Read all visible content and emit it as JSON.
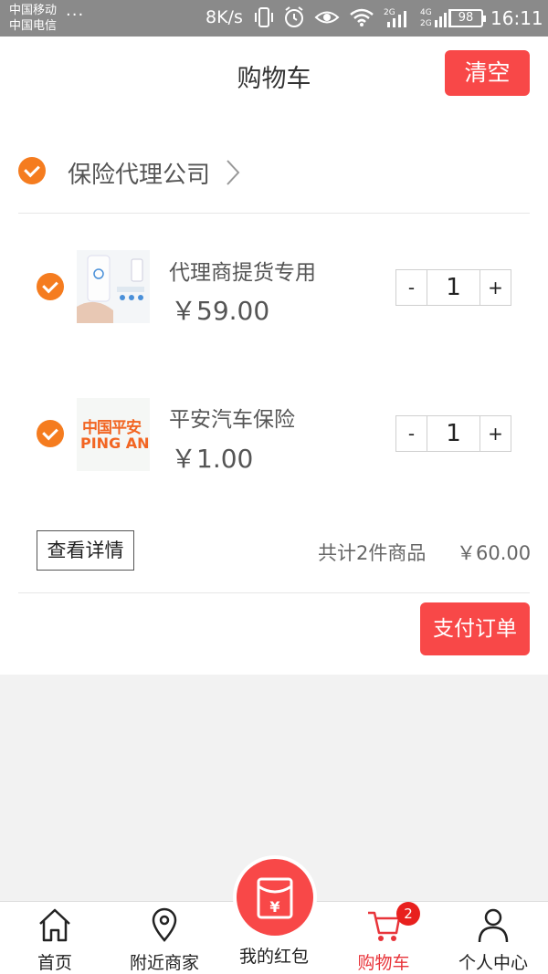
{
  "status_bar": {
    "carrier1": "中国移动",
    "carrier2": "中国电信",
    "more": "···",
    "speed": "8K/s",
    "battery": "98",
    "time": "16:11"
  },
  "header": {
    "title": "购物车",
    "clear_label": "清空"
  },
  "shop": {
    "name": "保险代理公司",
    "checked": true
  },
  "items": [
    {
      "name": "代理商提货专用",
      "price": "￥59.00",
      "qty": "1",
      "minus": "-",
      "plus": "+",
      "checked": true,
      "image": "dispenser-product-image"
    },
    {
      "name": "平安汽车保险",
      "price": "￥1.00",
      "qty": "1",
      "minus": "-",
      "plus": "+",
      "checked": true,
      "image": "pingan-logo-image"
    }
  ],
  "footer": {
    "detail_label": "查看详情",
    "summary": "共计2件商品",
    "total": "￥60.00",
    "pay_label": "支付订单"
  },
  "logo_text": {
    "line1": "中国平安",
    "line2": "PING AN"
  },
  "bottom_nav": {
    "items": [
      {
        "label": "首页",
        "icon": "home-icon"
      },
      {
        "label": "附近商家",
        "icon": "location-pin-icon"
      },
      {
        "label": "我的红包",
        "icon": "red-envelope-icon"
      },
      {
        "label": "购物车",
        "icon": "cart-icon",
        "badge": "2",
        "active": true
      },
      {
        "label": "个人中心",
        "icon": "person-icon"
      }
    ]
  },
  "colors": {
    "accent_red": "#f84848",
    "check_orange": "#f57c1f",
    "active_nav": "#e8343a"
  }
}
